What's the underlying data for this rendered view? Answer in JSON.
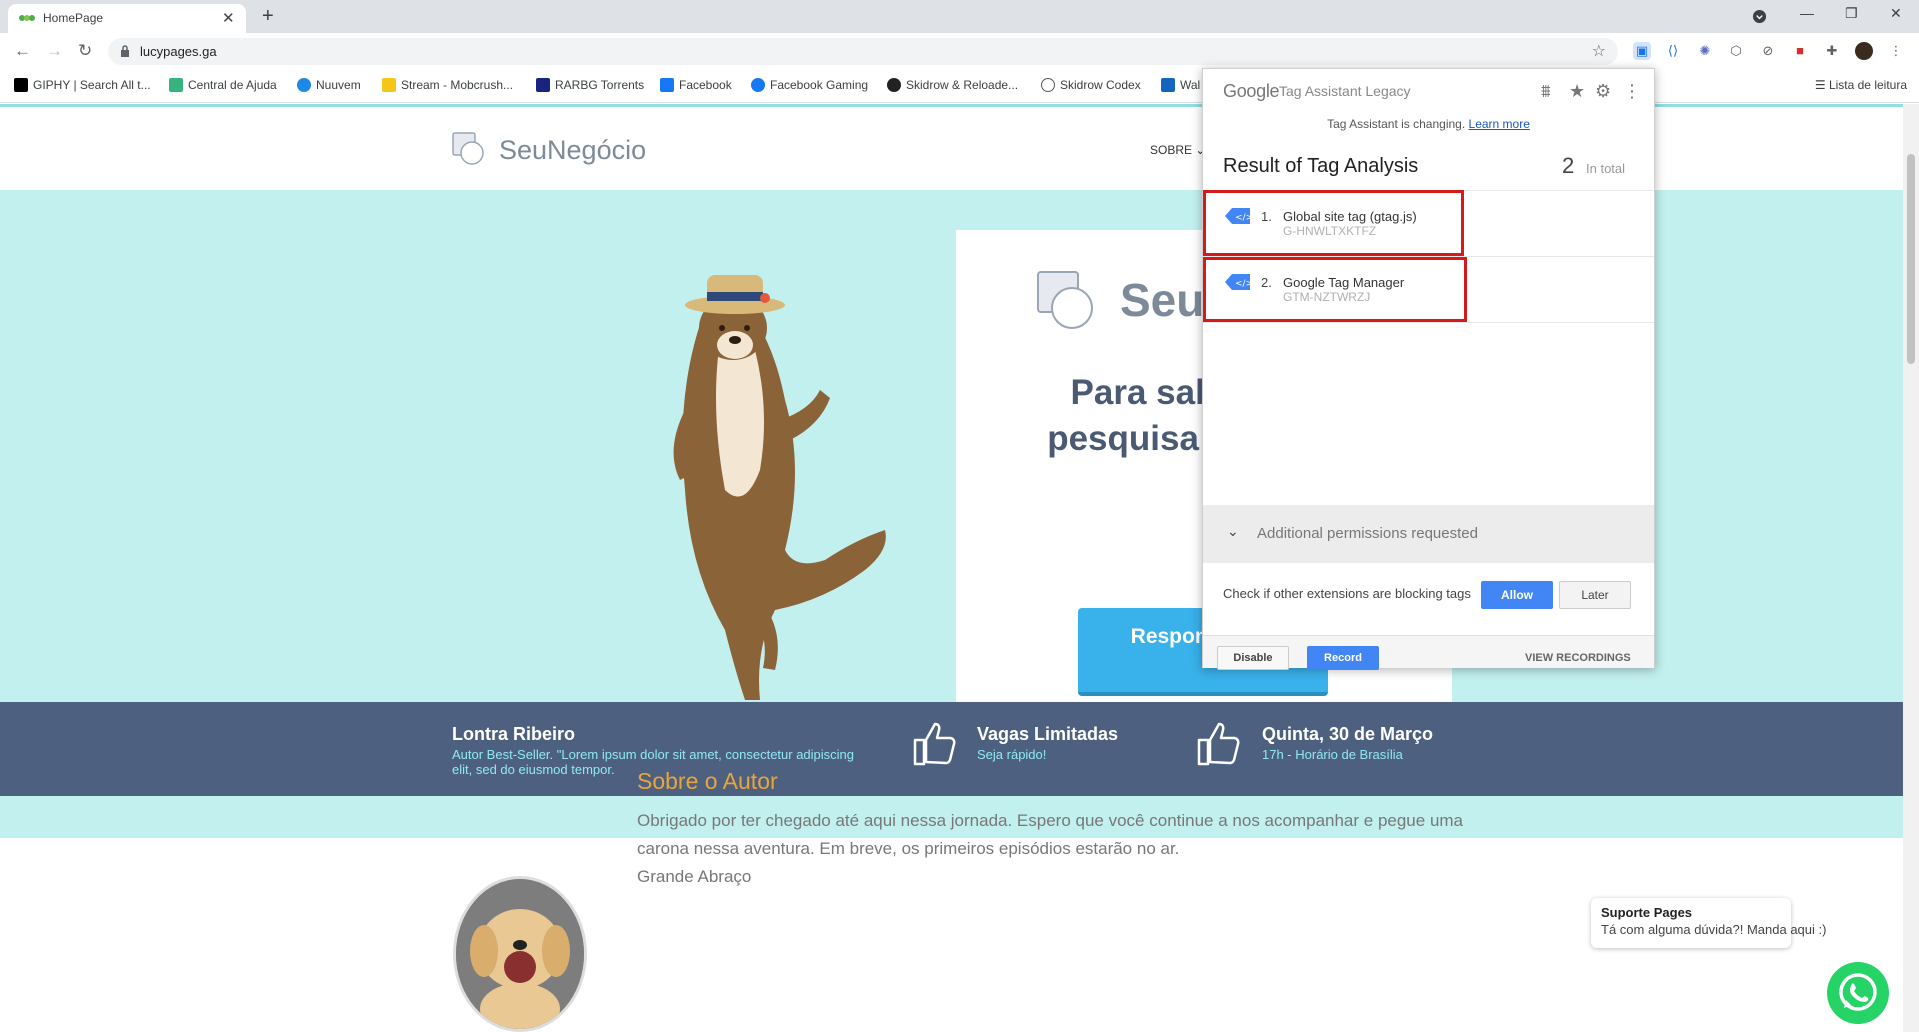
{
  "browser": {
    "tab_title": "HomePage",
    "tab_close": "✕",
    "new_tab": "+",
    "url": "lucypages.ga",
    "window_controls": {
      "minimize": "—",
      "restore": "❐",
      "close": "✕"
    },
    "bookmarks": [
      {
        "label": "GIPHY | Search All t...",
        "color": "#000000"
      },
      {
        "label": "Central de Ajuda",
        "color": "#36b37e"
      },
      {
        "label": "Nuuvem",
        "color": "#1e88e5"
      },
      {
        "label": "Stream - Mobcrush...",
        "color": "#f5c518"
      },
      {
        "label": "RARBG Torrents",
        "color": "#1a237e"
      },
      {
        "label": "Facebook",
        "color": "#1877f2"
      },
      {
        "label": "Facebook Gaming",
        "color": "#1877f2"
      },
      {
        "label": "Skidrow & Reloade...",
        "color": "#222222"
      },
      {
        "label": "Skidrow Codex",
        "color": "#555555"
      },
      {
        "label": "Wal",
        "color": "#1565c0"
      }
    ],
    "reading_list": "Lista de leitura"
  },
  "site": {
    "logo_text": "SeuNegócio",
    "nav_sobre": "SOBRE ⌄",
    "card_logo_text": "Seu",
    "card_heading": "Para sab respo pesquisa ofertas i",
    "card_button": "Respond pesq",
    "info": [
      {
        "title": "Lontra Ribeiro",
        "sub": "Autor Best-Seller. \"Lorem ipsum dolor sit amet, consectetur adipiscing elit, sed do eiusmod tempor."
      },
      {
        "title": "Vagas Limitadas",
        "sub": "Seja rápido!"
      },
      {
        "title": "Quinta, 30 de Março",
        "sub": "17h - Horário de Brasília"
      }
    ],
    "author_title": "Sobre o Autor",
    "author_text_1": "Obrigado por ter chegado até aqui nessa jornada. Espero que você continue a nos acompanhar e pegue uma carona nessa aventura. Em breve, os primeiros episódios estarão no ar.",
    "author_text_2": "Grande Abraço",
    "support_title": "Suporte Pages",
    "support_text": "Tá com alguma dúvida?! Manda aqui :)"
  },
  "tag_assistant": {
    "google": "Google",
    "product": "Tag Assistant Legacy",
    "changing": "Tag Assistant is changing.",
    "learn_more": "Learn more",
    "result_title": "Result of Tag Analysis",
    "total_count": "2",
    "total_label": "In total",
    "tags": [
      {
        "num": "1.",
        "name": "Global site tag (gtag.js)",
        "id": "G-HNWLTXKTFZ"
      },
      {
        "num": "2.",
        "name": "Google Tag Manager",
        "id": "GTM-NZTWRZJ"
      }
    ],
    "permissions": "Additional permissions requested",
    "check_text": "Check if other extensions are blocking tags",
    "allow": "Allow",
    "later": "Later",
    "disable": "Disable",
    "record": "Record",
    "view_recordings": "VIEW RECORDINGS"
  },
  "colors": {
    "hero_bg": "#c2f0ef",
    "infobar_bg": "#4d607f",
    "accent_orange": "#e8a53c",
    "button_blue": "#39b1ea",
    "highlight_red": "#d31b1b"
  }
}
